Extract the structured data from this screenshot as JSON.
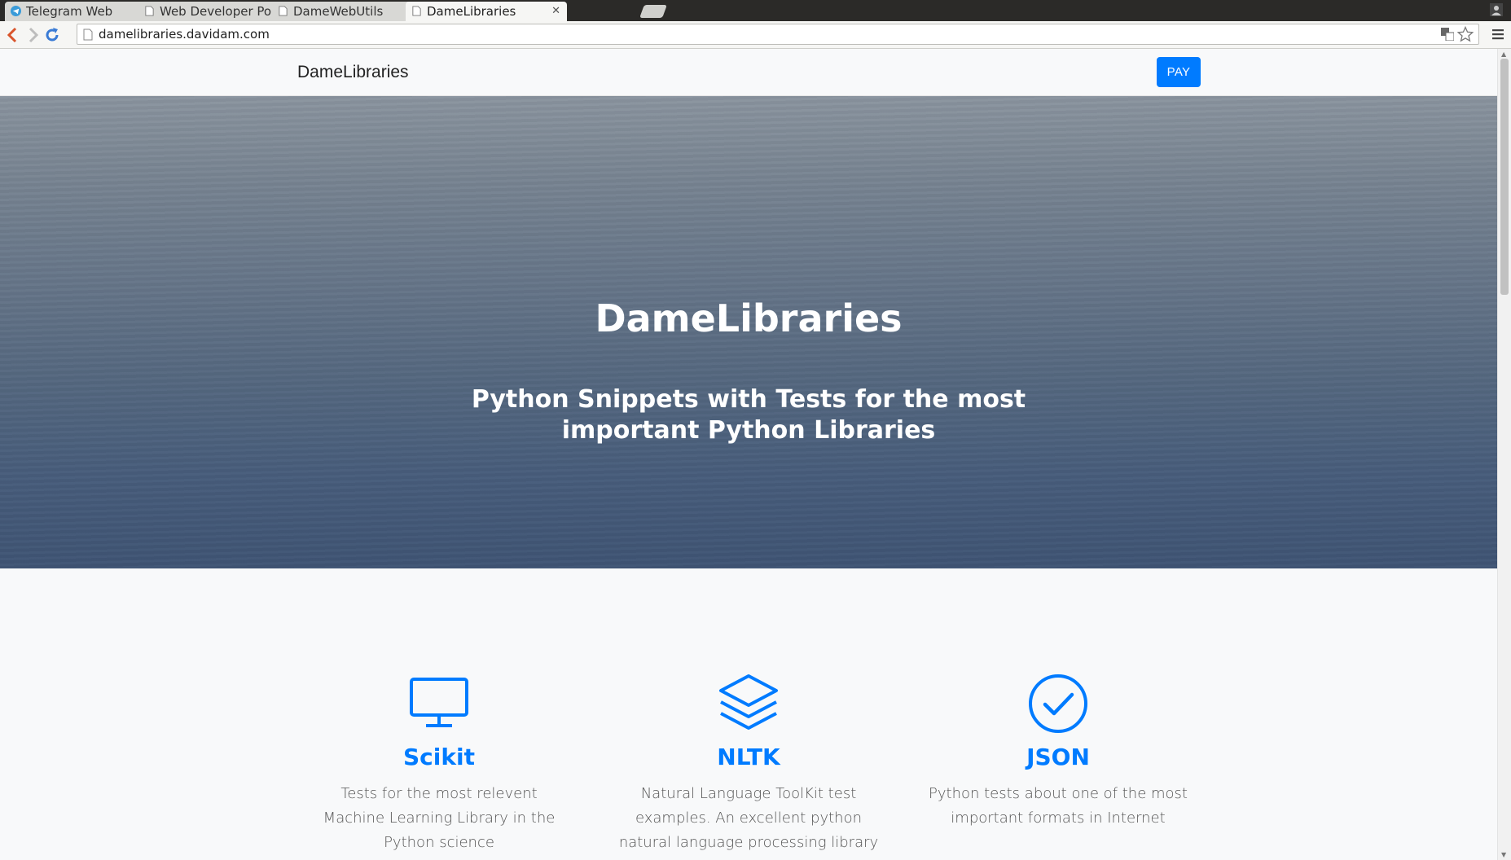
{
  "browser": {
    "tabs": [
      {
        "title": "Telegram Web",
        "icon": "telegram-icon",
        "active": false
      },
      {
        "title": "Web Developer Portal",
        "icon": "page-icon",
        "active": false
      },
      {
        "title": "DameWebUtils",
        "icon": "page-icon",
        "active": false
      },
      {
        "title": "DameLibraries",
        "icon": "page-icon",
        "active": true
      }
    ],
    "address": "damelibraries.davidam.com"
  },
  "nav": {
    "brand": "DameLibraries",
    "pay_label": "PAY"
  },
  "hero": {
    "title": "DameLibraries",
    "subtitle": "Python Snippets with Tests for the most important Python Libraries"
  },
  "features": [
    {
      "icon": "monitor-icon",
      "title": "Scikit",
      "text": "Tests for the most relevent Machine Learning Library in the Python science"
    },
    {
      "icon": "layers-icon",
      "title": "NLTK",
      "text": "Natural Language ToolKit test examples. An excellent python natural language processing library"
    },
    {
      "icon": "check-circle-icon",
      "title": "JSON",
      "text": "Python tests about one of the most important formats in Internet"
    }
  ],
  "colors": {
    "accent": "#007bff",
    "tabstrip": "#2b2a28"
  }
}
